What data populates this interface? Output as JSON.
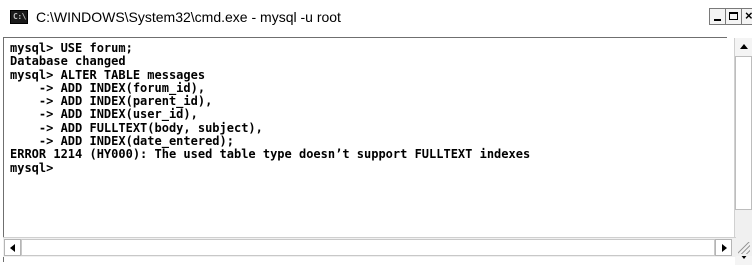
{
  "window": {
    "title": "C:\\WINDOWS\\System32\\cmd.exe - mysql -u root",
    "icon_text": "C:\\",
    "icons": {
      "app": "console-icon",
      "minimize": "minimize-icon",
      "maximize": "maximize-icon",
      "close": "close-icon"
    },
    "close_glyph": "×"
  },
  "console": {
    "lines": [
      "mysql> USE forum;",
      "Database changed",
      "mysql> ALTER TABLE messages",
      "    -> ADD INDEX(forum_id),",
      "    -> ADD INDEX(parent_id),",
      "    -> ADD INDEX(user_id),",
      "    -> ADD FULLTEXT(body, subject),",
      "    -> ADD INDEX(date_entered);",
      "ERROR 1214 (HY000): The used table type doesn’t support FULLTEXT indexes",
      "mysql>"
    ]
  },
  "colors": {
    "console_background": "#ffffff",
    "console_text": "#000000",
    "titlebar_background": "#ffffff"
  }
}
